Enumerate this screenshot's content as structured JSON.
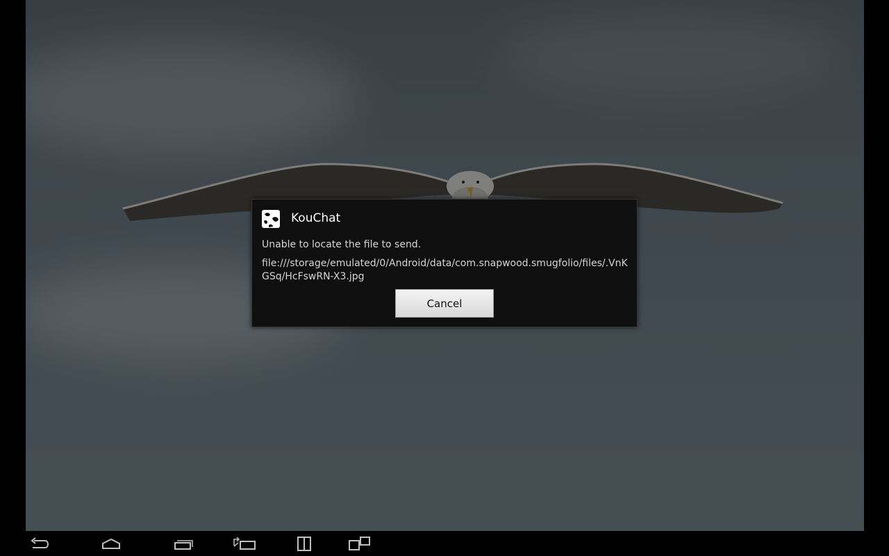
{
  "dialog": {
    "app_icon": "cow-icon",
    "title": "KouChat",
    "message": "Unable to locate the file to send.",
    "path": "file:///storage/emulated/0/Android/data/com.snapwood.smugfolio/files/.VnKGSq/HcFswRN-X3.jpg",
    "cancel_label": "Cancel"
  },
  "navbar": {
    "icons": [
      "back-icon",
      "home-icon",
      "recent-apps-icon",
      "rotate-screen-icon",
      "split-screen-icon",
      "multi-window-icon"
    ],
    "icon_color": "#bfbfbf"
  },
  "colors": {
    "dialog_bg": "#0f0f0f",
    "button_bg": "#e6e6e6"
  }
}
